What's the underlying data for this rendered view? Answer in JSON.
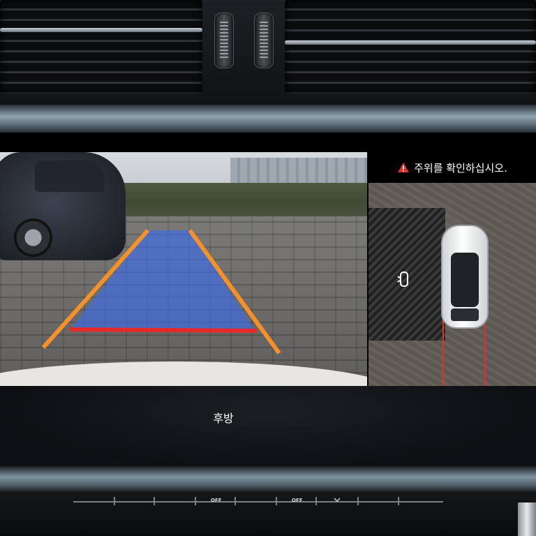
{
  "screen": {
    "warning_text": "주위를 확인하십시오.",
    "view_label": "후방"
  },
  "climate": {
    "left_off_label": "OFF",
    "right_off_label": "OFF"
  },
  "colors": {
    "guide_side_lines": "#f5912a",
    "guide_stop_line": "#e8292a",
    "guide_path_fill": "#3a6cf0",
    "proximity_lines": "#e0302a",
    "warning_triangle": "#e0302a"
  },
  "icons": {
    "warning": "warning-triangle-icon",
    "car_top": "car-top-view-icon",
    "sensor": "parking-sensor-icon",
    "chevron": "chevron-down-icon"
  }
}
